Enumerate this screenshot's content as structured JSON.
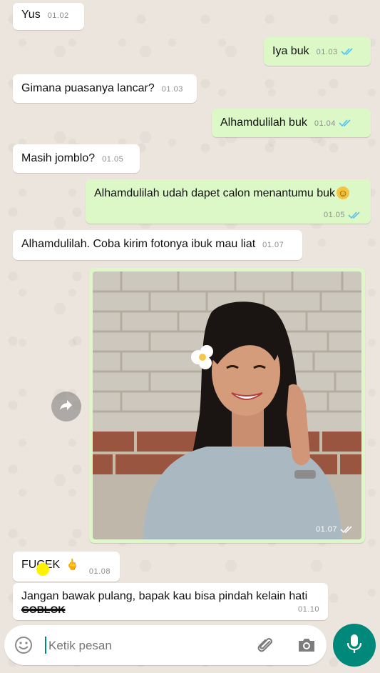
{
  "messages": [
    {
      "text": "Yus",
      "time": "01.02"
    },
    {
      "text": "Iya buk",
      "time": "01.03"
    },
    {
      "text": "Gimana puasanya lancar?",
      "time": "01.03"
    },
    {
      "text": "Alhamdulilah buk",
      "time": "01.04"
    },
    {
      "text": "Masih jomblo?",
      "time": "01.05"
    },
    {
      "text": "Alhamdulilah udah dapet calon menantumu buk",
      "emoji": "☺",
      "time": "01.05"
    },
    {
      "text": "Alhamdulilah. Coba kirim fotonya ibuk mau liat",
      "time": "01.07"
    },
    {
      "image_time": "01.07"
    },
    {
      "text": "FUCEK",
      "emoji": "🖕",
      "time": "01.08"
    },
    {
      "text": "Jangan bawak pulang, bapak kau bisa pindah kelain hati",
      "line2": "GOBLOK",
      "time": "01.10"
    }
  ],
  "input": {
    "placeholder": "Ketik pesan"
  },
  "icons": {
    "emoji": "emoji-icon",
    "attach": "paperclip-icon",
    "camera": "camera-icon",
    "mic": "microphone-icon",
    "forward": "forward-icon",
    "ticks": "double-check-icon"
  },
  "colors": {
    "background": "#ece5dd",
    "outgoing": "#dcf8c6",
    "incoming": "#ffffff",
    "accent": "#00897b",
    "tick_blue": "#4fc3f7"
  }
}
